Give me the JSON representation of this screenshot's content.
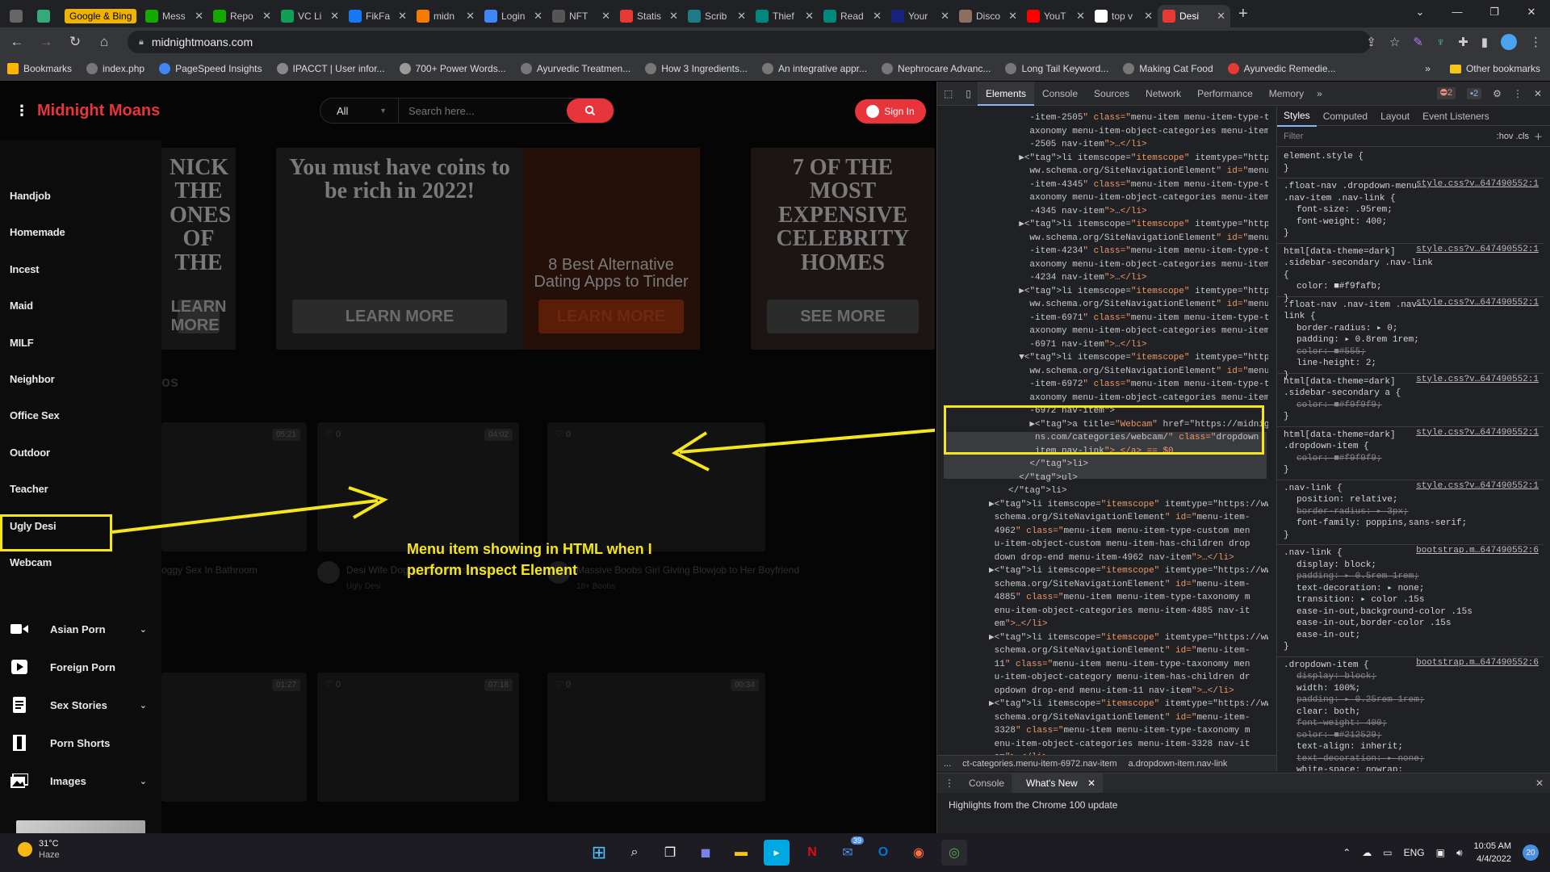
{
  "browser": {
    "tabs": [
      {
        "label": "",
        "icon": "whatsapp-icon",
        "color": "#666"
      },
      {
        "label": "",
        "icon": "app-icon",
        "color": "#3a7"
      },
      {
        "label": "Google & Bing",
        "icon": "google-icon",
        "color": "#f0b400"
      },
      {
        "label": "Mess",
        "icon": "upwork-icon",
        "color": "#14a800"
      },
      {
        "label": "Repo",
        "icon": "upwork-icon",
        "color": "#14a800"
      },
      {
        "label": "VC Li",
        "icon": "sheets-icon",
        "color": "#0f9d58"
      },
      {
        "label": "FikFa",
        "icon": "facebook-icon",
        "color": "#1877f2"
      },
      {
        "label": "midn",
        "icon": "cloud-icon",
        "color": "#f57c00"
      },
      {
        "label": "Login",
        "icon": "login-icon",
        "color": "#4285f4"
      },
      {
        "label": "NFT",
        "icon": "nft-icon",
        "color": "#555"
      },
      {
        "label": "Statis",
        "icon": "statista-icon",
        "color": "#e53935"
      },
      {
        "label": "Scrib",
        "icon": "scribd-icon",
        "color": "#1e7b85"
      },
      {
        "label": "Thief",
        "icon": "thief-icon",
        "color": "#00897b"
      },
      {
        "label": "Read",
        "icon": "read-icon",
        "color": "#00897b"
      },
      {
        "label": "Your",
        "icon": "your-icon",
        "color": "#1a237e"
      },
      {
        "label": "Disco",
        "icon": "disco-icon",
        "color": "#8d6e63"
      },
      {
        "label": "YouT",
        "icon": "youtube-icon",
        "color": "#ff0000"
      },
      {
        "label": "top v",
        "icon": "google-icon",
        "color": "#ffffff"
      },
      {
        "label": "Desi",
        "icon": "desi-icon",
        "color": "#e53935"
      }
    ],
    "url": "midnightmoans.com",
    "bookmarks": [
      {
        "label": "Bookmarks"
      },
      {
        "label": "index.php"
      },
      {
        "label": "PageSpeed Insights"
      },
      {
        "label": "IPACCT | User infor..."
      },
      {
        "label": "700+ Power Words..."
      },
      {
        "label": "Ayurvedic Treatmen..."
      },
      {
        "label": "How 3 Ingredients..."
      },
      {
        "label": "An integrative appr..."
      },
      {
        "label": "Nephrocare Advanc..."
      },
      {
        "label": "Long Tail Keyword..."
      },
      {
        "label": "Making Cat Food"
      },
      {
        "label": "Ayurvedic Remedie..."
      }
    ],
    "other_bookmarks": "Other bookmarks"
  },
  "site": {
    "logo": "Midnight Moans",
    "search_category": "All",
    "search_placeholder": "Search here...",
    "signin": "Sign In",
    "sidebar_items": [
      "Handjob",
      "Homemade",
      "Incest",
      "Maid",
      "MILF",
      "Neighbor",
      "Office Sex",
      "Outdoor",
      "Teacher",
      "Ugly Desi",
      "Webcam"
    ],
    "sidebar_icon_items": [
      {
        "label": "Asian Porn",
        "icon": "video-camera-icon",
        "chevron": true
      },
      {
        "label": "Foreign Porn",
        "icon": "play-icon",
        "chevron": false
      },
      {
        "label": "Sex Stories",
        "icon": "document-icon",
        "chevron": true
      },
      {
        "label": "Porn Shorts",
        "icon": "film-icon",
        "chevron": false
      },
      {
        "label": "Images",
        "icon": "images-icon",
        "chevron": true
      }
    ],
    "ads": [
      {
        "text": "NICK THE ONES OF THE",
        "button": "LEARN MORE"
      },
      {
        "text": "You must have coins to be rich in 2022!",
        "button": "LEARN MORE"
      },
      {
        "text": "8 Best Alternative Dating Apps to Tinder",
        "button": "LEARN MORE"
      },
      {
        "text": "7 OF THE MOST EXPENSIVE CELEBRITY HOMES",
        "button": "SEE MORE"
      }
    ],
    "section_label": "os",
    "cards": [
      {
        "badge": "05:21",
        "likes": "",
        "title": "oggy Sex In Bathroom",
        "meta": ""
      },
      {
        "badge": "04:02",
        "likes": "0",
        "title": "Desi Wife Doggy Style Pussy Fuck",
        "meta": "Ugly Desi"
      },
      {
        "badge": "",
        "likes": "0",
        "title": "Massive Boobs Girl Giving Blowjob to Her Boyfriend",
        "meta": "18+ Boobs"
      },
      {
        "badge": "01:27",
        "likes": "",
        "title": "",
        "meta": ""
      },
      {
        "badge": "07:18",
        "likes": "0",
        "title": "",
        "meta": ""
      },
      {
        "badge": "00:34",
        "likes": "0",
        "title": "",
        "meta": ""
      }
    ],
    "annotation": "Menu item showing in HTML when I perform Inspect Element"
  },
  "devtools": {
    "tabs": [
      "Elements",
      "Console",
      "Sources",
      "Network",
      "Performance",
      "Memory"
    ],
    "errors": "2",
    "messages": "2",
    "style_tabs": [
      "Styles",
      "Computed",
      "Layout",
      "Event Listeners"
    ],
    "filter": "Filter",
    "filter_right": ":hov  .cls",
    "breadcrumbs": [
      "...",
      "ct-categories.menu-item-6972.nav-item",
      "a.dropdown-item.nav-link"
    ],
    "drawer_tabs": [
      "Console",
      "What's New"
    ],
    "drawer_text": "Highlights from the Chrome 100 update",
    "element_lines": [
      "    -item-2505\" class=\"menu-item menu-item-type-t",
      "    axonomy menu-item-object-categories menu-item",
      "    -2505 nav-item\">…</li>",
      "  ▶<li itemscope=\"itemscope\" itemtype=\"https://w",
      "    ww.schema.org/SiteNavigationElement\" id=\"menu",
      "    -item-4345\" class=\"menu-item menu-item-type-t",
      "    axonomy menu-item-object-categories menu-item",
      "    -4345 nav-item\">…</li>",
      "  ▶<li itemscope=\"itemscope\" itemtype=\"https://w",
      "    ww.schema.org/SiteNavigationElement\" id=\"menu",
      "    -item-4234\" class=\"menu-item menu-item-type-t",
      "    axonomy menu-item-object-categories menu-item",
      "    -4234 nav-item\">…</li>",
      "  ▶<li itemscope=\"itemscope\" itemtype=\"https://w",
      "    ww.schema.org/SiteNavigationElement\" id=\"menu",
      "    -item-6971\" class=\"menu-item menu-item-type-t",
      "    axonomy menu-item-object-categories menu-item",
      "    -6971 nav-item\">…</li>",
      "  ▼<li itemscope=\"itemscope\" itemtype=\"https://w",
      "    ww.schema.org/SiteNavigationElement\" id=\"menu",
      "    -item-6972\" class=\"menu-item menu-item-type-t",
      "    axonomy menu-item-object-categories menu-item",
      "    -6972 nav-item\">",
      "    ▶<a title=\"Webcam\" href=\"https://midnightmo",
      "     ns.com/categories/webcam/\" class=\"dropdown",
      "     item nav-link\">…</a> == $0",
      "    </li>",
      "  </ul>",
      "</li>",
      "▶<li itemscope=\"itemscope\" itemtype=\"https://www.",
      " schema.org/SiteNavigationElement\" id=\"menu-item-",
      " 4962\" class=\"menu-item menu-item-type-custom men",
      " u-item-object-custom menu-item-has-children drop",
      " down drop-end menu-item-4962 nav-item\">…</li>",
      "▶<li itemscope=\"itemscope\" itemtype=\"https://www.",
      " schema.org/SiteNavigationElement\" id=\"menu-item-",
      " 4885\" class=\"menu-item menu-item-type-taxonomy m",
      " enu-item-object-categories menu-item-4885 nav-it",
      " em\">…</li>",
      "▶<li itemscope=\"itemscope\" itemtype=\"https://www.",
      " schema.org/SiteNavigationElement\" id=\"menu-item-",
      " 11\" class=\"menu-item menu-item-type-taxonomy men",
      " u-item-object-category menu-item-has-children dr",
      " opdown drop-end menu-item-11 nav-item\">…</li>",
      "▶<li itemscope=\"itemscope\" itemtype=\"https://www.",
      " schema.org/SiteNavigationElement\" id=\"menu-item-",
      " 3328\" class=\"menu-item menu-item-type-taxonomy m",
      " enu-item-object-categories menu-item-3328 nav-it",
      " em\">…</li>"
    ],
    "style_rules": [
      {
        "selector": "element.style {",
        "source": "",
        "props": [],
        "close": "}"
      },
      {
        "selector": ".float-nav .dropdown-menu .nav-item .nav-link {",
        "source": "style.css?v…647490552:1",
        "props": [
          "font-size: .95rem;",
          "font-weight: 400;"
        ],
        "close": "}"
      },
      {
        "selector": "html[data-theme=dark] .sidebar-secondary .nav-link {",
        "source": "style.css?v…647490552:1",
        "props": [
          "color: ■#f9fafb;"
        ],
        "close": "}"
      },
      {
        "selector": ".float-nav .nav-item .nav-link {",
        "source": "style.css?v…647490552:1",
        "props": [
          "border-radius: ▸ 0;",
          "padding: ▸ 0.8rem 1rem;",
          "color: ■#555;",
          "line-height: 2;"
        ],
        "close": "}"
      },
      {
        "selector": "html[data-theme=dark] .sidebar-secondary a {",
        "source": "style.css?v…647490552:1",
        "props": [
          "color: ■#f9f9f9;"
        ],
        "close": "}"
      },
      {
        "selector": "html[data-theme=dark] .dropdown-item {",
        "source": "style.css?v…647490552:1",
        "props": [
          "color: ■#f9f9f9;"
        ],
        "close": "}"
      },
      {
        "selector": ".nav-link {",
        "source": "style.css?v…647490552:1",
        "props": [
          "position: relative;",
          "border-radius: ▸ 3px;",
          "font-family: poppins,sans-serif;"
        ],
        "close": "}"
      },
      {
        "selector": ".nav-link {",
        "source": "bootstrap.m…647490552:6",
        "props": [
          "display: block;",
          "padding: ▸ 0.5rem 1rem;",
          "text-decoration: ▸ none;",
          "transition: ▸ color .15s",
          "    ease-in-out,background-color .15s",
          "    ease-in-out,border-color .15s",
          "    ease-in-out;"
        ],
        "close": "}"
      },
      {
        "selector": ".dropdown-item {",
        "source": "bootstrap.m…647490552:6",
        "props": [
          "display: block;",
          "width: 100%;",
          "padding: ▸ 0.25rem 1rem;",
          "clear: both;",
          "font-weight: 400;",
          "color: ■#212529;",
          "text-align: inherit;",
          "text-decoration: ▸ none;",
          "white-space: nowrap;"
        ],
        "close": ""
      }
    ]
  },
  "taskbar": {
    "temp": "31°C",
    "weather": "Haze",
    "lang": "ENG",
    "time": "10:05 AM",
    "date": "4/4/2022",
    "notif": "20",
    "mail_badge": "39"
  }
}
